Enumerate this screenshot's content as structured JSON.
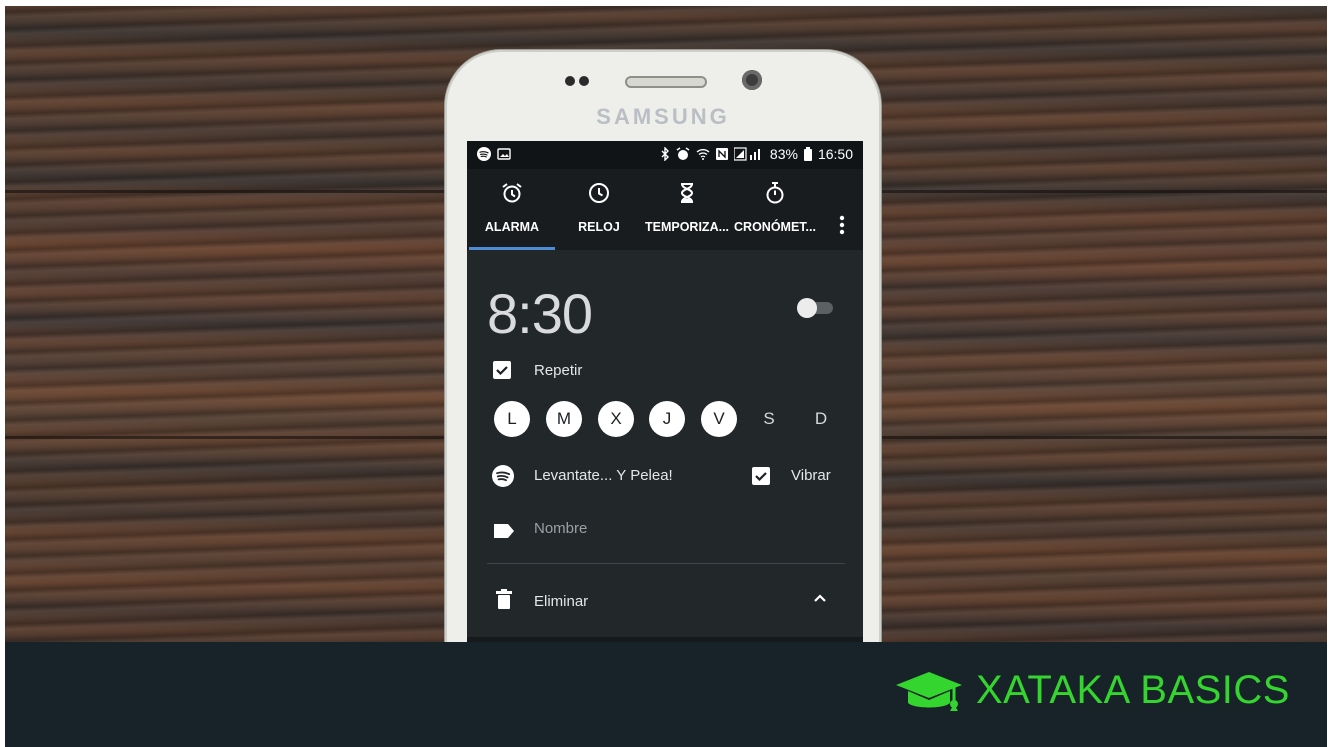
{
  "phone": {
    "brand": "SAMSUNG"
  },
  "status_bar": {
    "battery": "83%",
    "clock": "16:50"
  },
  "tabs": [
    {
      "label": "ALARMA",
      "icon": "alarm-icon",
      "active": true
    },
    {
      "label": "RELOJ",
      "icon": "clock-icon",
      "active": false
    },
    {
      "label": "TEMPORIZA...",
      "icon": "hourglass-icon",
      "active": false
    },
    {
      "label": "CRONÓMET...",
      "icon": "stopwatch-icon",
      "active": false
    }
  ],
  "alarm": {
    "time": "8:30",
    "enabled": false,
    "repeat_label": "Repetir",
    "repeat_checked": true,
    "days": [
      {
        "letter": "L",
        "selected": true
      },
      {
        "letter": "M",
        "selected": true
      },
      {
        "letter": "X",
        "selected": true
      },
      {
        "letter": "J",
        "selected": true
      },
      {
        "letter": "V",
        "selected": true
      },
      {
        "letter": "S",
        "selected": false
      },
      {
        "letter": "D",
        "selected": false
      }
    ],
    "ringtone": "Levantate... Y Pelea!",
    "vibrate_label": "Vibrar",
    "vibrate_checked": true,
    "name_placeholder": "Nombre",
    "delete_label": "Eliminar"
  },
  "footer": {
    "brand_text": "XATAKA BASICS",
    "brand_color": "#35d52f",
    "bar_color": "#182229"
  }
}
